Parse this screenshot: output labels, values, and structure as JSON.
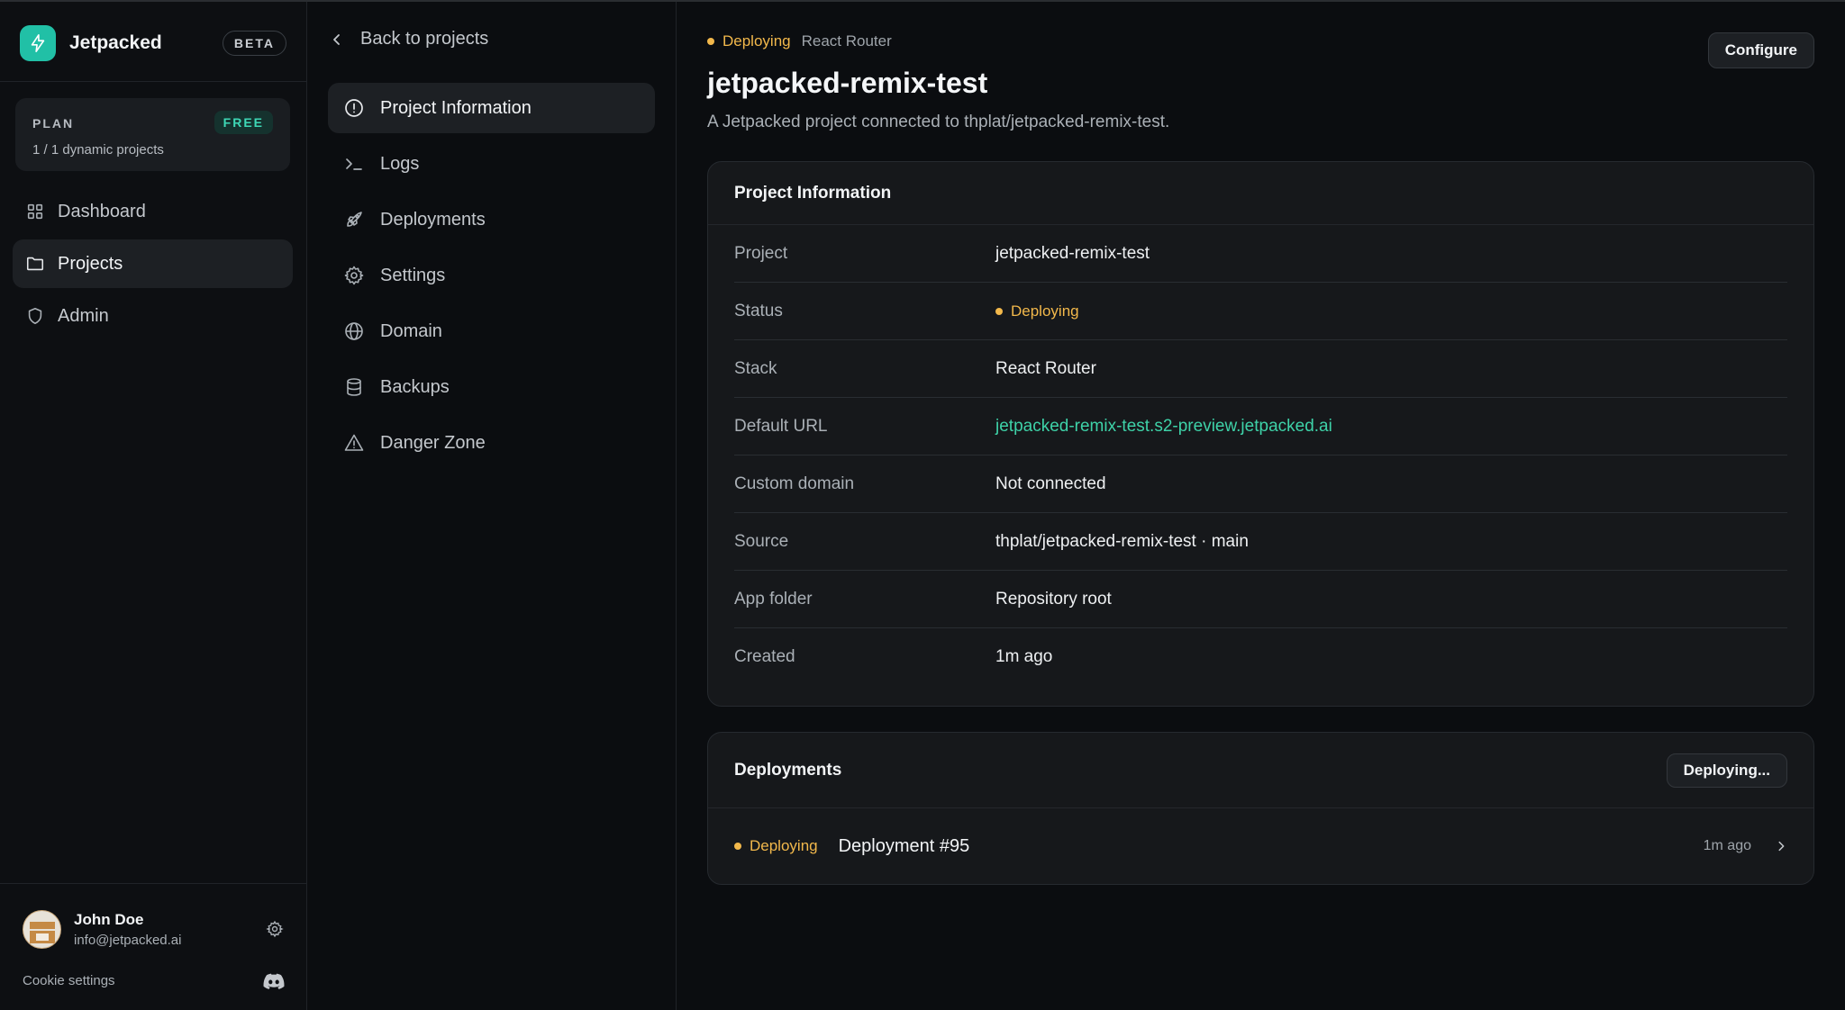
{
  "brand": {
    "name": "Jetpacked",
    "badge": "BETA"
  },
  "plan": {
    "label": "PLAN",
    "badge": "FREE",
    "usage": "1 / 1 dynamic projects"
  },
  "nav": {
    "items": [
      {
        "label": "Dashboard",
        "icon": "grid-icon"
      },
      {
        "label": "Projects",
        "icon": "folder-icon"
      },
      {
        "label": "Admin",
        "icon": "shield-icon"
      }
    ]
  },
  "user": {
    "name": "John Doe",
    "email": "info@jetpacked.ai",
    "cookie": "Cookie settings"
  },
  "subnav": {
    "back": "Back to projects",
    "items": [
      {
        "label": "Project Information",
        "icon": "info-icon"
      },
      {
        "label": "Logs",
        "icon": "terminal-icon"
      },
      {
        "label": "Deployments",
        "icon": "rocket-icon"
      },
      {
        "label": "Settings",
        "icon": "gear-icon"
      },
      {
        "label": "Domain",
        "icon": "globe-icon"
      },
      {
        "label": "Backups",
        "icon": "database-icon"
      },
      {
        "label": "Danger Zone",
        "icon": "warning-icon"
      }
    ]
  },
  "header": {
    "status": "Deploying",
    "stack": "React Router",
    "configure": "Configure",
    "title": "jetpacked-remix-test",
    "description": "A Jetpacked project connected to thplat/jetpacked-remix-test."
  },
  "info": {
    "title": "Project Information",
    "rows": [
      {
        "label": "Project",
        "value": "jetpacked-remix-test"
      },
      {
        "label": "Status",
        "value": "Deploying"
      },
      {
        "label": "Stack",
        "value": "React Router"
      },
      {
        "label": "Default URL",
        "value": "jetpacked-remix-test.s2-preview.jetpacked.ai"
      },
      {
        "label": "Custom domain",
        "value": "Not connected"
      },
      {
        "label": "Source",
        "value": "thplat/jetpacked-remix-test · main"
      },
      {
        "label": "App folder",
        "value": "Repository root"
      },
      {
        "label": "Created",
        "value": "1m ago"
      }
    ]
  },
  "deployments": {
    "title": "Deployments",
    "button": "Deploying...",
    "items": [
      {
        "status": "Deploying",
        "name": "Deployment #95",
        "time": "1m ago"
      }
    ]
  },
  "colors": {
    "accent": "#21c0a6",
    "link": "#3ed2a8",
    "warning": "#f2b84b",
    "background": "#0b0d10"
  }
}
